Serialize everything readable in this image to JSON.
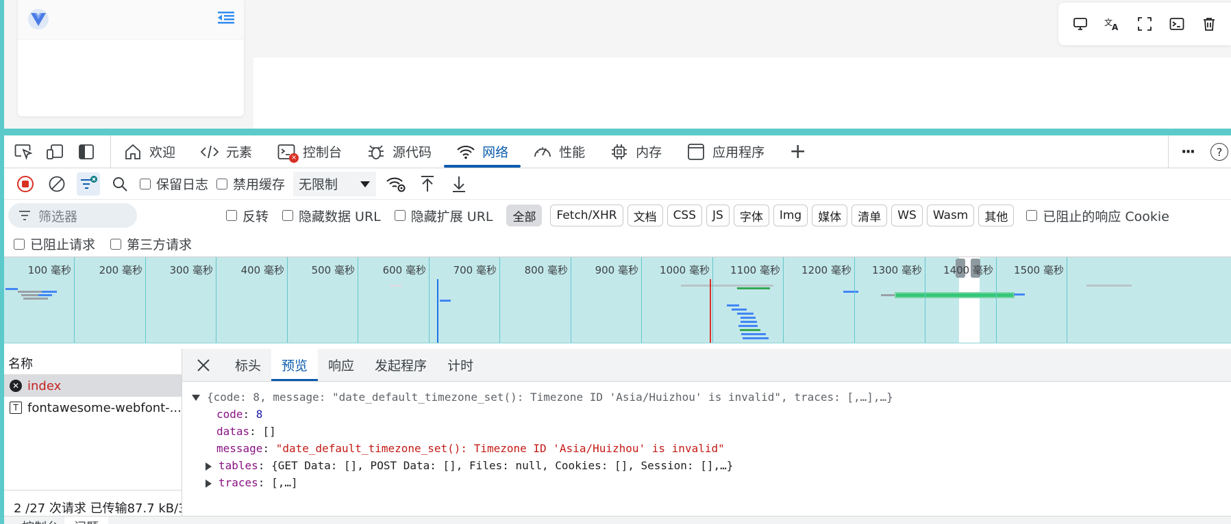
{
  "floating_toolbar": {
    "icons": [
      "monitor-icon",
      "translate-icon",
      "fullscreen-icon",
      "terminal-icon",
      "trash-icon"
    ]
  },
  "tabs": [
    {
      "label": "欢迎",
      "icon": "home-icon"
    },
    {
      "label": "元素",
      "icon": "code-icon"
    },
    {
      "label": "控制台",
      "icon": "console-icon",
      "badge": "×"
    },
    {
      "label": "源代码",
      "icon": "bug-icon"
    },
    {
      "label": "网络",
      "icon": "wifi-icon",
      "active": true
    },
    {
      "label": "性能",
      "icon": "gauge-icon"
    },
    {
      "label": "内存",
      "icon": "chip-icon"
    },
    {
      "label": "应用程序",
      "icon": "window-icon"
    }
  ],
  "tabs_plus": "+",
  "tabs_more": "···",
  "tabs_help": "?",
  "toolbar": {
    "preserve_log": "保留日志",
    "disable_cache": "禁用缓存",
    "throttle_value": "无限制"
  },
  "filter": {
    "placeholder": "筛选器",
    "invert": "反转",
    "hide_data_url": "隐藏数据 URL",
    "hide_ext_url": "隐藏扩展 URL",
    "chips": [
      "全部",
      "Fetch/XHR",
      "文档",
      "CSS",
      "JS",
      "字体",
      "Img",
      "媒体",
      "清单",
      "WS",
      "Wasm",
      "其他"
    ],
    "blocked_cookies": "已阻止的响应 Cookie",
    "blocked_requests": "已阻止请求",
    "third_party": "第三方请求"
  },
  "overview": {
    "ticks": [
      "100 毫秒",
      "200 毫秒",
      "300 毫秒",
      "400 毫秒",
      "500 毫秒",
      "600 毫秒",
      "700 毫秒",
      "800 毫秒",
      "900 毫秒",
      "1000 毫秒",
      "1100 毫秒",
      "1200 毫秒",
      "1300 毫秒",
      "1400 毫秒",
      "1500 毫秒"
    ]
  },
  "requests": {
    "header": "名称",
    "items": [
      {
        "name": "index",
        "status": "error"
      },
      {
        "name": "fontawesome-webfont-...",
        "status": "font"
      }
    ],
    "footer": "2 /27 次请求  已传输87.7 kB/3"
  },
  "detail": {
    "tabs": [
      "标头",
      "预览",
      "响应",
      "发起程序",
      "计时"
    ],
    "active_tab": "预览",
    "summary": "{code: 8, message: \"date_default_timezone_set(): Timezone ID 'Asia/Huizhou' is invalid\", traces: [,…],…}",
    "code_key": "code",
    "code_val": "8",
    "datas_key": "datas",
    "datas_val": "[]",
    "message_key": "message",
    "message_val": "\"date_default_timezone_set(): Timezone ID 'Asia/Huizhou' is invalid\"",
    "tables_key": "tables",
    "tables_val": "{GET Data: [], POST Data: [], Files: null, Cookies: [], Session: [],…}",
    "traces_key": "traces",
    "traces_val": "[,…]"
  },
  "drawer": {
    "tabs": [
      "控制台",
      "问题"
    ]
  },
  "colors": {
    "accent": "#0b5cad",
    "teal": "#5ccaca",
    "error": "#c5221f"
  }
}
